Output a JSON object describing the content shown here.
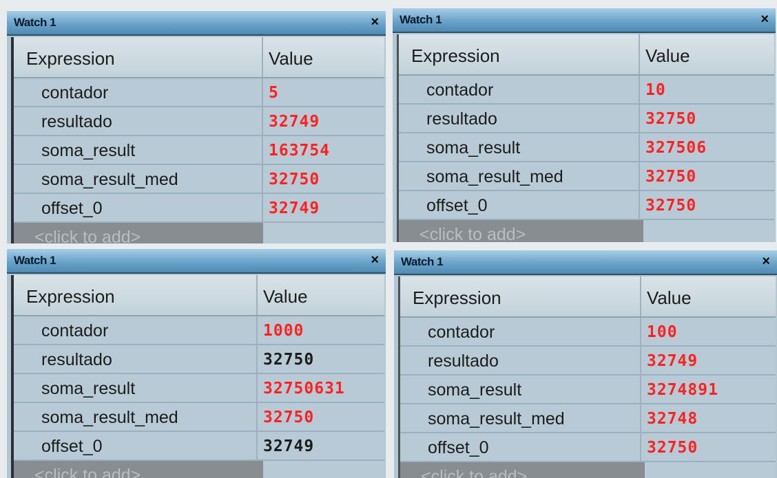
{
  "colors": {
    "changed_value": "#ff2020",
    "unchanged_value": "#1c1c1c",
    "titlebar": "#6aa3c9",
    "add_row_bg": "#878d91"
  },
  "panels": [
    {
      "title": "Watch 1",
      "close_label": "×",
      "headers": {
        "expression": "Expression",
        "value": "Value"
      },
      "rows": [
        {
          "expression": "contador",
          "value": "5",
          "changed": true
        },
        {
          "expression": "resultado",
          "value": "32749",
          "changed": true
        },
        {
          "expression": "soma_result",
          "value": "163754",
          "changed": true
        },
        {
          "expression": "soma_result_med",
          "value": "32750",
          "changed": true
        },
        {
          "expression": "offset_0",
          "value": "32749",
          "changed": true
        }
      ],
      "add_label": "<click to add>"
    },
    {
      "title": "Watch 1",
      "close_label": "×",
      "headers": {
        "expression": "Expression",
        "value": "Value"
      },
      "rows": [
        {
          "expression": "contador",
          "value": "10",
          "changed": true
        },
        {
          "expression": "resultado",
          "value": "32750",
          "changed": true
        },
        {
          "expression": "soma_result",
          "value": "327506",
          "changed": true
        },
        {
          "expression": "soma_result_med",
          "value": "32750",
          "changed": true
        },
        {
          "expression": "offset_0",
          "value": "32750",
          "changed": true
        }
      ],
      "add_label": "<click to add>"
    },
    {
      "title": "Watch 1",
      "close_label": "×",
      "headers": {
        "expression": "Expression",
        "value": "Value"
      },
      "rows": [
        {
          "expression": "contador",
          "value": "1000",
          "changed": true
        },
        {
          "expression": "resultado",
          "value": "32750",
          "changed": false
        },
        {
          "expression": "soma_result",
          "value": "32750631",
          "changed": true
        },
        {
          "expression": "soma_result_med",
          "value": "32750",
          "changed": true
        },
        {
          "expression": "offset_0",
          "value": "32749",
          "changed": false
        }
      ],
      "add_label": "<click to add>"
    },
    {
      "title": "Watch 1",
      "close_label": "×",
      "headers": {
        "expression": "Expression",
        "value": "Value"
      },
      "rows": [
        {
          "expression": "contador",
          "value": "100",
          "changed": true
        },
        {
          "expression": "resultado",
          "value": "32749",
          "changed": true
        },
        {
          "expression": "soma_result",
          "value": "3274891",
          "changed": true
        },
        {
          "expression": "soma_result_med",
          "value": "32748",
          "changed": true
        },
        {
          "expression": "offset_0",
          "value": "32750",
          "changed": true
        }
      ],
      "add_label": "<click to add>"
    }
  ]
}
